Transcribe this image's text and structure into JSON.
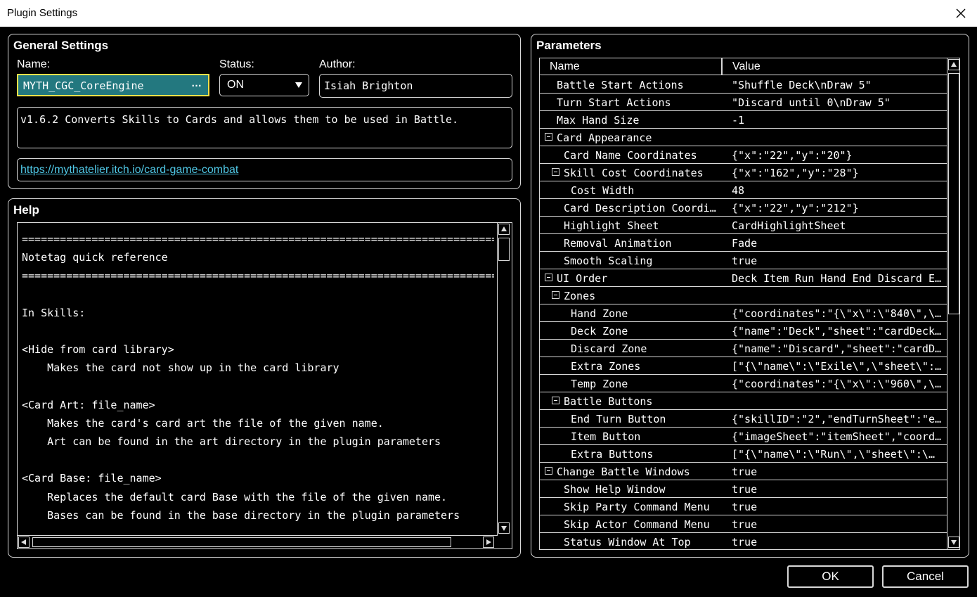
{
  "window": {
    "title": "Plugin Settings"
  },
  "general": {
    "title": "General Settings",
    "name_label": "Name:",
    "name_value": "MYTH_CGC_CoreEngine",
    "name_dots": "…",
    "status_label": "Status:",
    "status_value": "ON",
    "author_label": "Author:",
    "author_value": "Isiah Brighton",
    "description": "v1.6.2 Converts Skills to Cards and allows them to be used in Battle.",
    "url": "https://mythatelier.itch.io/card-game-combat"
  },
  "help": {
    "title": "Help",
    "lines": [
      "================================================================================",
      "Notetag quick reference",
      "================================================================================",
      "",
      "In Skills:",
      "",
      "<Hide from card library>",
      "    Makes the card not show up in the card library",
      "",
      "<Card Art: file_name>",
      "    Makes the card's card art the file of the given name.",
      "    Art can be found in the art directory in the plugin parameters",
      "",
      "<Card Base: file_name>",
      "    Replaces the default card Base with the file of the given name.",
      "    Bases can be found in the base directory in the plugin parameters"
    ]
  },
  "params": {
    "title": "Parameters",
    "col_name": "Name",
    "col_value": "Value",
    "rows": [
      {
        "name": "Battle Start Actions",
        "value": "\"Shuffle Deck\\nDraw 5\"",
        "indent": 0,
        "expander": false
      },
      {
        "name": "Turn Start Actions",
        "value": "\"Discard until 0\\nDraw 5\"",
        "indent": 0,
        "expander": false
      },
      {
        "name": "Max Hand Size",
        "value": "-1",
        "indent": 0,
        "expander": false
      },
      {
        "name": "Card Appearance",
        "value": "",
        "indent": 0,
        "expander": true
      },
      {
        "name": "Card Name Coordinates",
        "value": "{\"x\":\"22\",\"y\":\"20\"}",
        "indent": 1,
        "expander": false
      },
      {
        "name": "Skill Cost Coordinates",
        "value": "{\"x\":\"162\",\"y\":\"28\"}",
        "indent": 1,
        "expander": true
      },
      {
        "name": "Cost Width",
        "value": "48",
        "indent": 2,
        "expander": false
      },
      {
        "name": "Card Description Coordi…",
        "value": "{\"x\":\"22\",\"y\":\"212\"}",
        "indent": 1,
        "expander": false
      },
      {
        "name": "Highlight Sheet",
        "value": "CardHighlightSheet",
        "indent": 1,
        "expander": false
      },
      {
        "name": "Removal Animation",
        "value": "Fade",
        "indent": 1,
        "expander": false
      },
      {
        "name": "Smooth Scaling",
        "value": "true",
        "indent": 1,
        "expander": false
      },
      {
        "name": "UI Order",
        "value": "Deck Item Run Hand End Discard E…",
        "indent": 0,
        "expander": true
      },
      {
        "name": "Zones",
        "value": "",
        "indent": 1,
        "expander": true
      },
      {
        "name": "Hand Zone",
        "value": "{\"coordinates\":\"{\\\"x\\\":\\\"840\\\",\\…",
        "indent": 2,
        "expander": false
      },
      {
        "name": "Deck Zone",
        "value": "{\"name\":\"Deck\",\"sheet\":\"cardDeck…",
        "indent": 2,
        "expander": false
      },
      {
        "name": "Discard Zone",
        "value": "{\"name\":\"Discard\",\"sheet\":\"cardD…",
        "indent": 2,
        "expander": false
      },
      {
        "name": "Extra Zones",
        "value": "[\"{\\\"name\\\":\\\"Exile\\\",\\\"sheet\\\":…",
        "indent": 2,
        "expander": false
      },
      {
        "name": "Temp Zone",
        "value": "{\"coordinates\":\"{\\\"x\\\":\\\"960\\\",\\…",
        "indent": 2,
        "expander": false
      },
      {
        "name": "Battle Buttons",
        "value": "",
        "indent": 1,
        "expander": true
      },
      {
        "name": "End Turn Button",
        "value": "{\"skillID\":\"2\",\"endTurnSheet\":\"e…",
        "indent": 2,
        "expander": false
      },
      {
        "name": "Item Button",
        "value": "{\"imageSheet\":\"itemSheet\",\"coord…",
        "indent": 2,
        "expander": false
      },
      {
        "name": "Extra Buttons",
        "value": "[\"{\\\"name\\\":\\\"Run\\\",\\\"sheet\\\":\\…",
        "indent": 2,
        "expander": false
      },
      {
        "name": "Change Battle Windows",
        "value": "true",
        "indent": 0,
        "expander": true
      },
      {
        "name": "Show Help Window",
        "value": "true",
        "indent": 1,
        "expander": false
      },
      {
        "name": "Skip Party Command Menu",
        "value": "true",
        "indent": 1,
        "expander": false
      },
      {
        "name": "Skip Actor Command Menu",
        "value": "true",
        "indent": 1,
        "expander": false
      },
      {
        "name": "Status Window At Top",
        "value": "true",
        "indent": 1,
        "expander": false
      }
    ]
  },
  "buttons": {
    "ok": "OK",
    "cancel": "Cancel"
  },
  "colors": {
    "name_field_bg": "#23787f",
    "name_field_border": "#f3e14a",
    "link": "#4fc6e4"
  }
}
